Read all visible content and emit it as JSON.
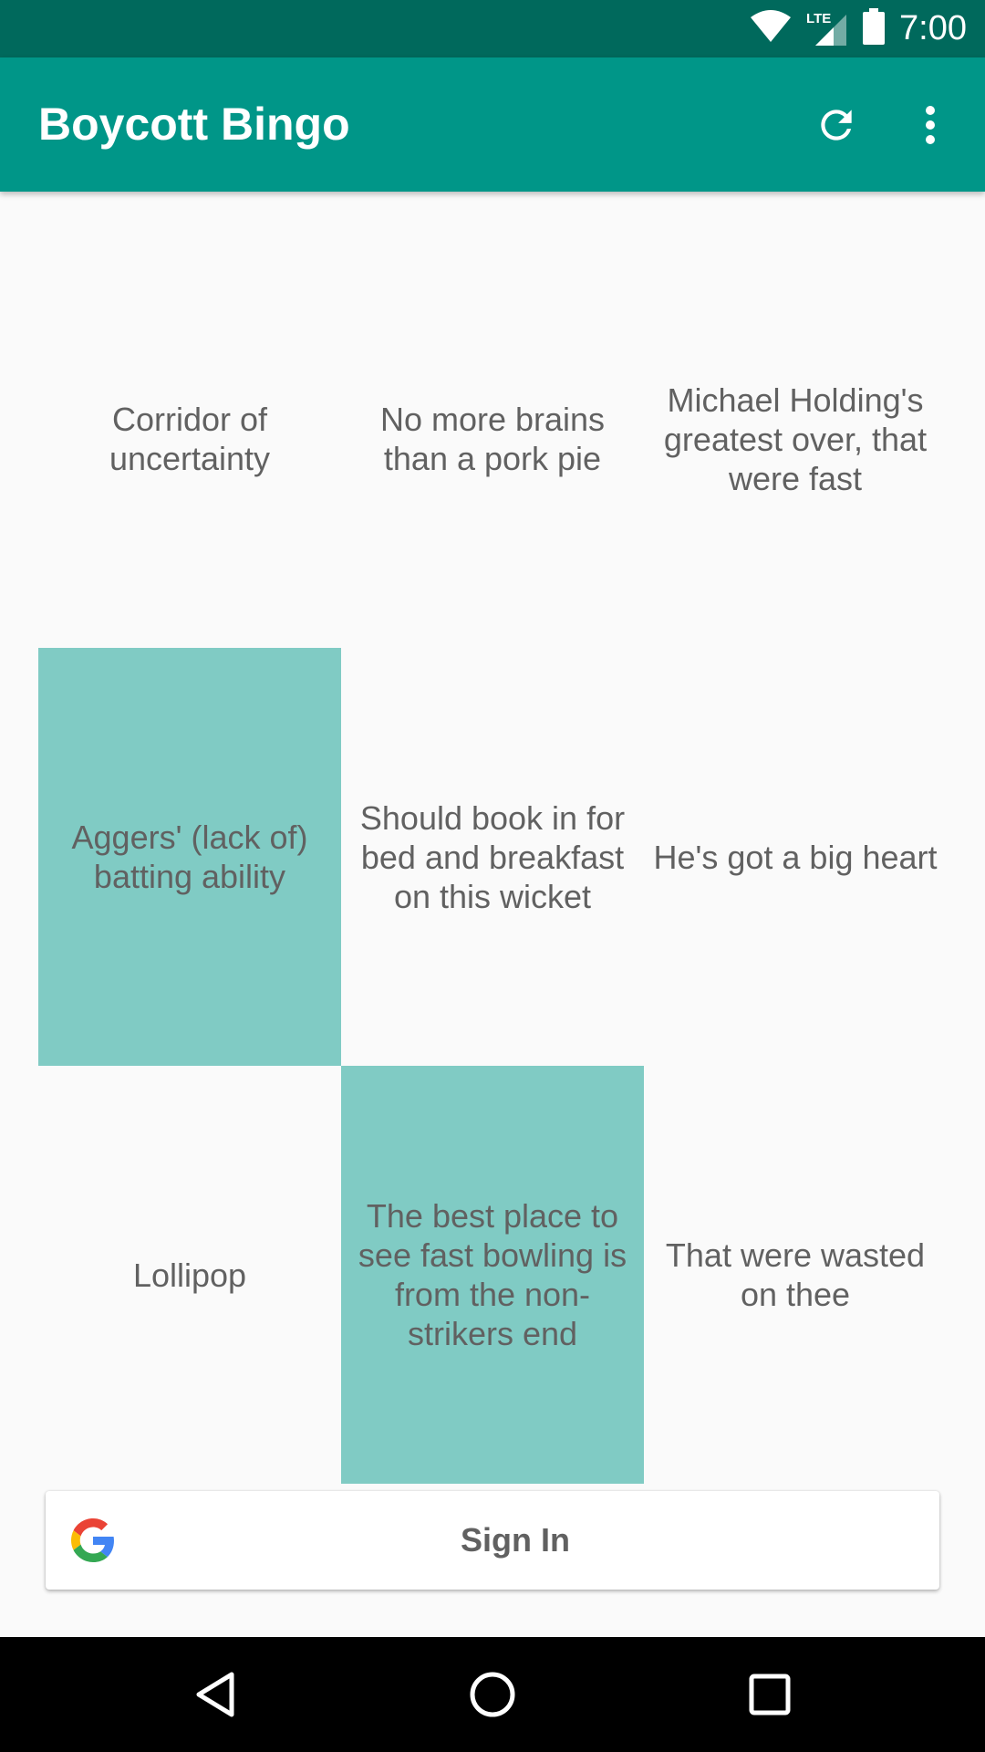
{
  "status_bar": {
    "time": "7:00",
    "network": "LTE",
    "icons": [
      "wifi-icon",
      "cellular-signal-icon",
      "battery-icon"
    ]
  },
  "app_bar": {
    "title": "Boycott Bingo",
    "actions": [
      "refresh-icon",
      "more-vert-icon"
    ]
  },
  "grid": {
    "cells": [
      {
        "text": "Corridor of uncertainty",
        "marked": false
      },
      {
        "text": "No more brains than a pork pie",
        "marked": false
      },
      {
        "text": "Michael Holding's greatest over, that were fast",
        "marked": false
      },
      {
        "text": "Aggers' (lack of) batting ability",
        "marked": true
      },
      {
        "text": "Should book in for bed and breakfast on this wicket",
        "marked": false
      },
      {
        "text": "He's got a big heart",
        "marked": false
      },
      {
        "text": "Lollipop",
        "marked": false
      },
      {
        "text": "The best place to see fast bowling is from the non-strikers end",
        "marked": true
      },
      {
        "text": "That were wasted on thee",
        "marked": false
      }
    ]
  },
  "sign_in": {
    "label": "Sign In",
    "icon": "google-icon"
  },
  "nav_bar": {
    "buttons": [
      "back-icon",
      "home-icon",
      "recents-icon"
    ]
  },
  "colors": {
    "status_bar": "#00695c",
    "app_bar": "#009688",
    "marked_cell": "#80cbc4",
    "cell_text": "#616161",
    "background": "#fafafa"
  }
}
